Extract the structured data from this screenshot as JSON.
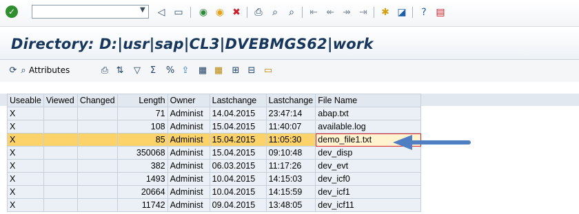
{
  "title": "Directory: D:|usr|sap|CL3|DVEBMGS62|work",
  "toolbar": {
    "command_value": "",
    "icons": [
      "enter-icon",
      "back-icon",
      "save-icon",
      "back-arrow-icon",
      "exit-icon",
      "cancel-icon",
      "print-icon",
      "find-icon",
      "find-next-icon",
      "first-page-icon",
      "previous-page-icon",
      "next-page-icon",
      "last-page-icon",
      "new-session-icon",
      "shortcut-icon",
      "help-icon",
      "layout-icon"
    ]
  },
  "app_toolbar": {
    "attributes_label": "Attributes",
    "icons": [
      "refresh-icon",
      "display-icon",
      "print-icon",
      "sort-ascending-icon",
      "filter-icon",
      "sum-icon",
      "subtotal-icon",
      "export-icon",
      "layout-icon",
      "grid-icon",
      "insert-column-icon",
      "delete-column-icon",
      "folder-icon"
    ]
  },
  "table": {
    "headers": [
      "Useable",
      "Viewed",
      "Changed",
      "Length",
      "Owner",
      "Lastchange",
      "Lastchange",
      "File Name"
    ],
    "rows": [
      {
        "useable": "X",
        "viewed": "",
        "changed": "",
        "length": "71",
        "owner": "Administ",
        "date": "14.04.2015",
        "time": "23:47:14",
        "file": "abap.txt"
      },
      {
        "useable": "X",
        "viewed": "",
        "changed": "",
        "length": "108",
        "owner": "Administ",
        "date": "15.04.2015",
        "time": "11:40:07",
        "file": "available.log"
      },
      {
        "useable": "X",
        "viewed": "",
        "changed": "",
        "length": "85",
        "owner": "Administ",
        "date": "15.04.2015",
        "time": "11:05:30",
        "file": "demo_file1.txt"
      },
      {
        "useable": "X",
        "viewed": "",
        "changed": "",
        "length": "350068",
        "owner": "Administ",
        "date": "15.04.2015",
        "time": "09:10:48",
        "file": "dev_disp"
      },
      {
        "useable": "X",
        "viewed": "",
        "changed": "",
        "length": "382",
        "owner": "Administ",
        "date": "06.03.2015",
        "time": "11:17:26",
        "file": "dev_evt"
      },
      {
        "useable": "X",
        "viewed": "",
        "changed": "",
        "length": "1493",
        "owner": "Administ",
        "date": "10.04.2015",
        "time": "14:15:03",
        "file": "dev_icf0"
      },
      {
        "useable": "X",
        "viewed": "",
        "changed": "",
        "length": "20664",
        "owner": "Administ",
        "date": "10.04.2015",
        "time": "14:15:59",
        "file": "dev_icf1"
      },
      {
        "useable": "X",
        "viewed": "",
        "changed": "",
        "length": "11742",
        "owner": "Administ",
        "date": "09.04.2015",
        "time": "13:48:05",
        "file": "dev_icf11"
      }
    ],
    "selected_row": 2
  },
  "colors": {
    "title": "#16365c",
    "selected_row": "#fcd36b",
    "highlight_border": "#e0242c",
    "arrow": "#4f7fc2"
  }
}
